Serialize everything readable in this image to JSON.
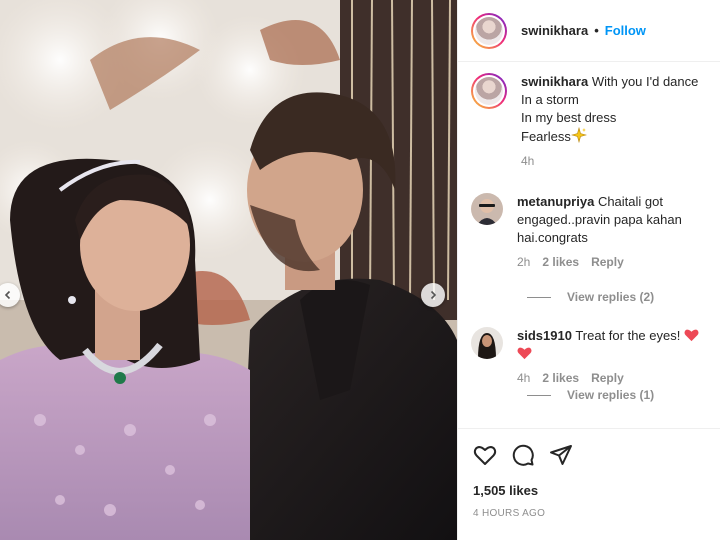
{
  "post": {
    "username": "swinikhara",
    "follow_label": "Follow",
    "separator": "•"
  },
  "caption": {
    "username": "swinikhara",
    "lines": [
      "With you I'd dance",
      "In a storm",
      "In my best dress",
      "Fearless"
    ],
    "emoji": "sparkles-icon",
    "time": "4h"
  },
  "comments": [
    {
      "username": "metanupriya",
      "text": "Chaitali got engaged..pravin papa kahan hai.congrats",
      "time": "2h",
      "likes": "2 likes",
      "reply": "Reply",
      "view_replies": "View replies (2)"
    },
    {
      "username": "sids1910",
      "text": "Treat for the eyes!",
      "emoji": [
        "red-heart-icon",
        "red-heart-icon"
      ],
      "time": "4h",
      "likes": "2 likes",
      "reply": "Reply",
      "view_replies": "View replies (1)"
    }
  ],
  "footer": {
    "likes": "1,505 likes",
    "timestamp": "4 HOURS AGO"
  },
  "colors": {
    "accent": "#0095f6",
    "muted": "#8e8e8e",
    "heart": "#ed4956"
  }
}
